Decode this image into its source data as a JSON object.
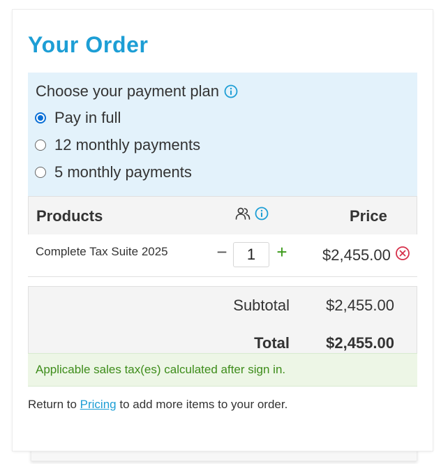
{
  "order": {
    "title": "Your Order",
    "payment_plan": {
      "heading": "Choose your payment plan",
      "info_icon": "info-circle-icon",
      "options": [
        {
          "label": "Pay in full",
          "selected": true
        },
        {
          "label": "12 monthly payments",
          "selected": false
        },
        {
          "label": "5 monthly payments",
          "selected": false
        }
      ]
    },
    "table": {
      "header": {
        "products": "Products",
        "users_icon": "users-icon",
        "info_icon": "info-circle-icon",
        "price": "Price"
      },
      "items": [
        {
          "name": "Complete Tax Suite 2025",
          "quantity": "1",
          "minus": "−",
          "plus": "+",
          "price": "$2,455.00",
          "remove_icon": "remove-circle-icon"
        }
      ],
      "subtotal_label": "Subtotal",
      "subtotal_value": "$2,455.00",
      "total_label": "Total",
      "total_value": "$2,455.00"
    },
    "tax_notice": "Applicable sales tax(es) calculated after sign in.",
    "footer": {
      "prefix": "Return to ",
      "link": "Pricing",
      "suffix": " to add more items to your order."
    },
    "colors": {
      "accent": "#1d9ed5",
      "plan_bg": "#e3f2fb",
      "success_text": "#3d8c1a",
      "success_bg": "#edf6e6",
      "remove": "#d6304a",
      "radio_selected": "#0a6fd6"
    }
  }
}
